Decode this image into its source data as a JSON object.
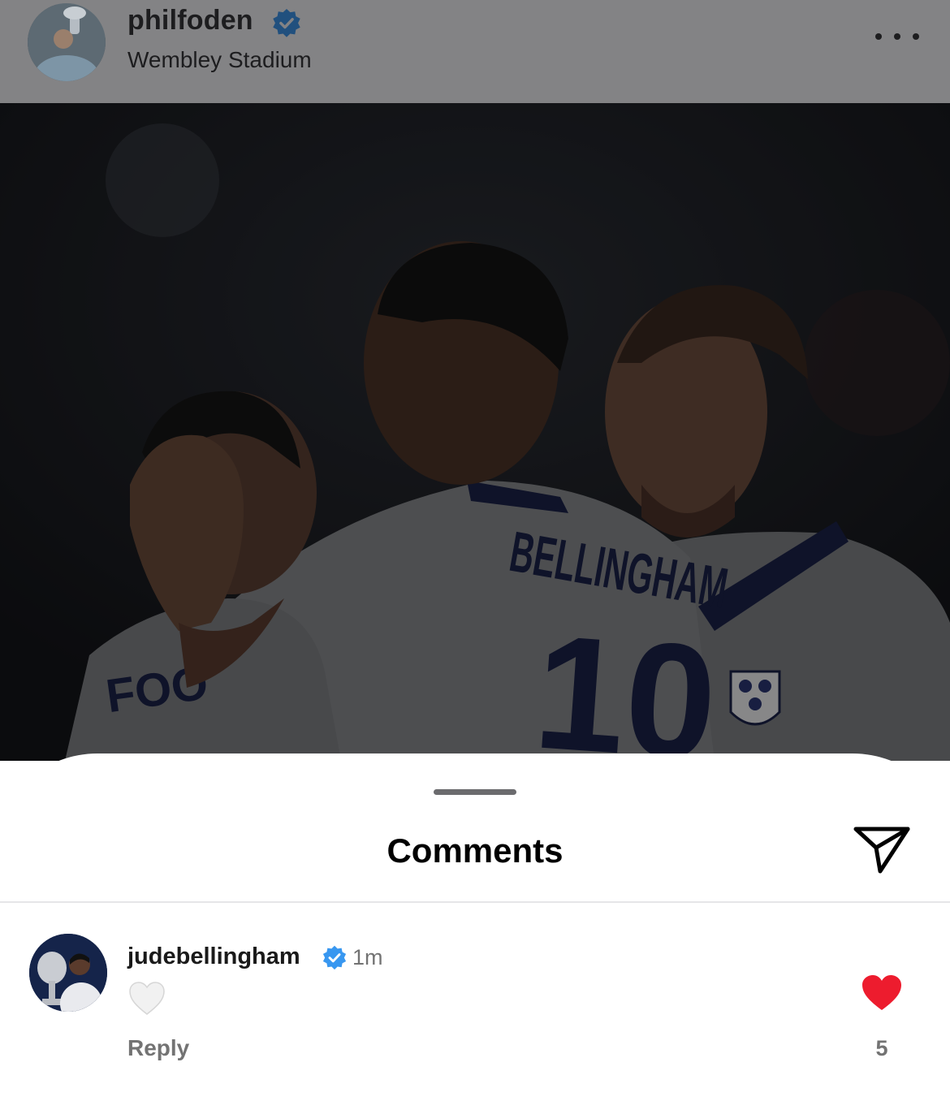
{
  "post": {
    "username": "philfoden",
    "location": "Wembley Stadium",
    "image": {
      "shirt_name": "BELLINGHAM",
      "shirt_number": "10",
      "shirt_name_left": "FOO"
    }
  },
  "comments_sheet": {
    "title": "Comments",
    "comments": [
      {
        "username": "judebellingham",
        "time": "1m",
        "text_emoji": "white-heart",
        "reply_label": "Reply",
        "like_count": "5"
      }
    ]
  },
  "colors": {
    "verified": "#3897f0",
    "like": "#ed1c2e",
    "dim_overlay": "rgba(0,0,0,0.5)"
  },
  "icons": {
    "verified": "verified-badge-icon",
    "more": "more-options-icon",
    "share": "paper-plane-icon",
    "like": "heart-filled-icon",
    "white_heart": "white-heart-emoji-icon"
  }
}
